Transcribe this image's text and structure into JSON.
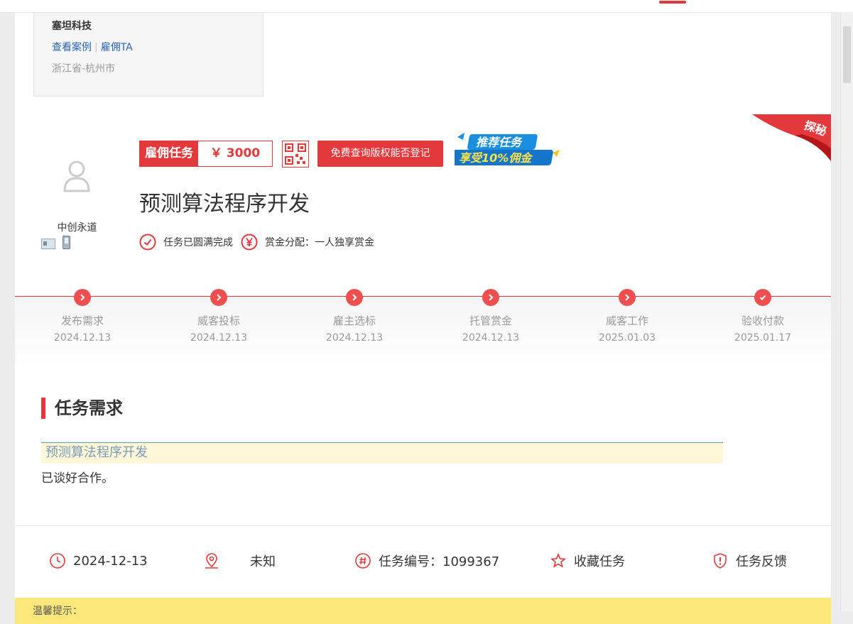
{
  "company": {
    "name": "塞坦科技",
    "link_cases": "查看案例",
    "link_hire": "雇佣TA",
    "location": "浙江省-杭州市"
  },
  "corner_badge": "探秘",
  "employer": {
    "name": "中创永道"
  },
  "task": {
    "type_label": "雇佣任务",
    "price": "￥ 3000",
    "query_button": "免费查询版权能否登记",
    "promo_line1": "推荐任务",
    "promo_line2": "享受10%佣金",
    "title": "预测算法程序开发",
    "status": "任务已圆满完成",
    "reward": "赏金分配：一人独享赏金"
  },
  "steps": [
    {
      "name": "发布需求",
      "date": "2024.12.13",
      "icon": "chevron-right-icon"
    },
    {
      "name": "威客投标",
      "date": "2024.12.13",
      "icon": "chevron-right-icon"
    },
    {
      "name": "雇主选标",
      "date": "2024.12.13",
      "icon": "chevron-right-icon"
    },
    {
      "name": "托管赏金",
      "date": "2024.12.13",
      "icon": "chevron-right-icon"
    },
    {
      "name": "威客工作",
      "date": "2025.01.03",
      "icon": "chevron-right-icon"
    },
    {
      "name": "验收付款",
      "date": "2025.01.17",
      "icon": "check-icon"
    }
  ],
  "requirements": {
    "section_title": "任务需求",
    "title": "预测算法程序开发",
    "description": "已谈好合作。"
  },
  "meta": {
    "date": "2024-12-13",
    "location": "未知",
    "task_number": "任务编号：1099367",
    "favorite": "收藏任务",
    "feedback": "任务反馈"
  },
  "tip": "温馨提示：",
  "colors": {
    "accent": "#e4393c",
    "link": "#2a64b0",
    "tip_bg": "#fce87a"
  }
}
